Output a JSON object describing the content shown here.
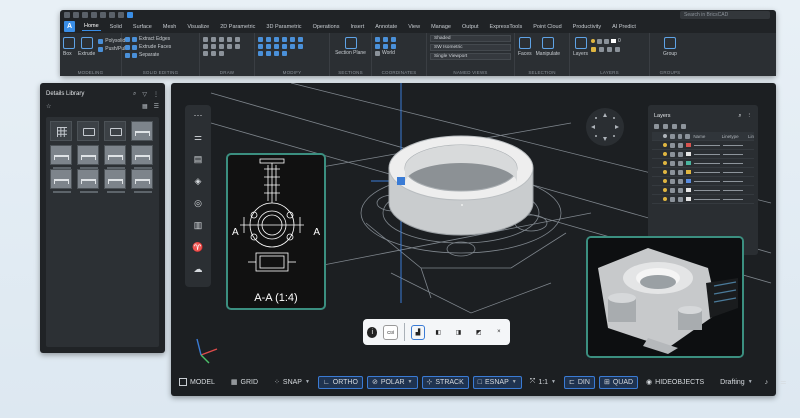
{
  "ribbon": {
    "search_placeholder": "Search in BricsCAD",
    "app_icon": "A",
    "tabs": [
      "Home",
      "Solid",
      "Surface",
      "Mesh",
      "Visualize",
      "2D Parametric",
      "3D Parametric",
      "Operations",
      "Insert",
      "Annotate",
      "View",
      "Manage",
      "Output",
      "ExpressTools",
      "Point Cloud",
      "Productivity",
      "AI Predict"
    ],
    "active_tab": "Home",
    "groups": {
      "modeling": {
        "label": "MODELING",
        "items": [
          "Box",
          "Extrude"
        ],
        "extra": [
          "Polysolid",
          "Push/Pull"
        ]
      },
      "solid_editing": {
        "label": "SOLID EDITING",
        "items": [
          "Extract Edges",
          "Extrude Faces",
          "Separate"
        ]
      },
      "draw": {
        "label": "DRAW"
      },
      "modify": {
        "label": "MODIFY"
      },
      "sections": {
        "label": "SECTIONS",
        "items": [
          "Section Plane"
        ]
      },
      "coordinates": {
        "label": "COORDINATES",
        "items": [
          "World"
        ]
      },
      "named_views": {
        "label": "NAMED VIEWS",
        "items": [
          "Shaded",
          "SW Isometric",
          "Single Viewport"
        ]
      },
      "selection": {
        "label": "SELECTION",
        "items": [
          "Faces",
          "Manipulate"
        ]
      },
      "layers": {
        "label": "LAYERS",
        "items": [
          "Layers"
        ],
        "layer_value": "0"
      },
      "groups": {
        "label": "GROUPS",
        "items": [
          "Group"
        ]
      }
    }
  },
  "library": {
    "title": "Details Library"
  },
  "viewport": {
    "section_caption": "A-A (1:4)",
    "section_letter_left": "A",
    "section_letter_right": "A",
    "quad_key_label": "Ctrl",
    "quad_close": "×"
  },
  "layers_panel": {
    "title": "Layers",
    "columns": [
      "Name",
      "Linetype",
      "Lin"
    ],
    "rows": [
      {
        "color": "#d9534f"
      },
      {
        "color": "#e6e6e6"
      },
      {
        "color": "#4ab5a0"
      },
      {
        "color": "#e0b640"
      },
      {
        "color": "#5b8de0"
      },
      {
        "color": "#e6e6e6"
      },
      {
        "color": "#e6e6e6"
      }
    ]
  },
  "statusbar": {
    "model": "MODEL",
    "grid": "GRID",
    "snap": "SNAP",
    "ortho": "ORTHO",
    "polar": "POLAR",
    "strack": "STRACK",
    "esnap": "ESNAP",
    "scale": "1:1",
    "din": "DIN",
    "quad": "QUAD",
    "hideobjects": "HIDEOBJECTS",
    "workspace": "Drafting"
  },
  "colors": {
    "accent": "#3a8ee6",
    "panel_frame": "#3b8f80"
  }
}
